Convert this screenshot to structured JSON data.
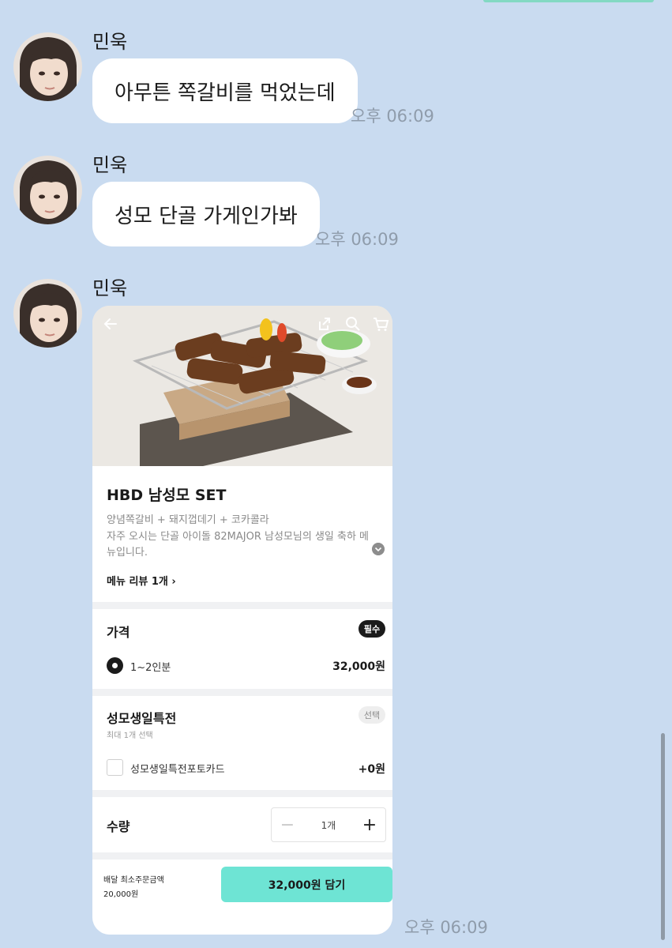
{
  "messages": [
    {
      "sender": "민욱",
      "text": "아무튼 쪽갈비를 먹었는데",
      "time": "오후 06:09"
    },
    {
      "sender": "민욱",
      "text": "성모 단골 가게인가봐",
      "time": "오후 06:09"
    },
    {
      "sender": "민욱",
      "time": "오후 06:09"
    }
  ],
  "card": {
    "icons": {
      "back": "back-arrow-icon",
      "share": "share-icon",
      "search": "search-icon",
      "cart": "cart-icon"
    },
    "product": {
      "name": "HBD 남성모 SET",
      "desc_line1": "양념쪽갈비 + 돼지껍데기 + 코카콜라",
      "desc_line2": "자주 오시는 단골 아이돌 82MAJOR 남성모님의 생일 축하 메",
      "desc_line3": "뉴입니다.",
      "review_link": "메뉴 리뷰 1개 ›"
    },
    "price_section": {
      "title": "가격",
      "badge": "필수",
      "option_label": "1~2인분",
      "option_price": "32,000원",
      "selected": true
    },
    "special_section": {
      "title": "성모생일특전",
      "badge": "선택",
      "subtitle": "최대 1개 선택",
      "option_label": "성모생일특전포토카드",
      "option_price": "+0원",
      "checked": false
    },
    "quantity": {
      "label": "수량",
      "minus": "−",
      "value": "1개",
      "plus": "+"
    },
    "footer": {
      "min_order_label": "배달 최소주문금액",
      "min_order_value": "20,000원",
      "button": "32,000원 담기"
    }
  },
  "colors": {
    "background": "#c9dbf0",
    "bubble": "#ffffff",
    "time": "#8f9cab",
    "cart_button": "#6ee4d4"
  }
}
